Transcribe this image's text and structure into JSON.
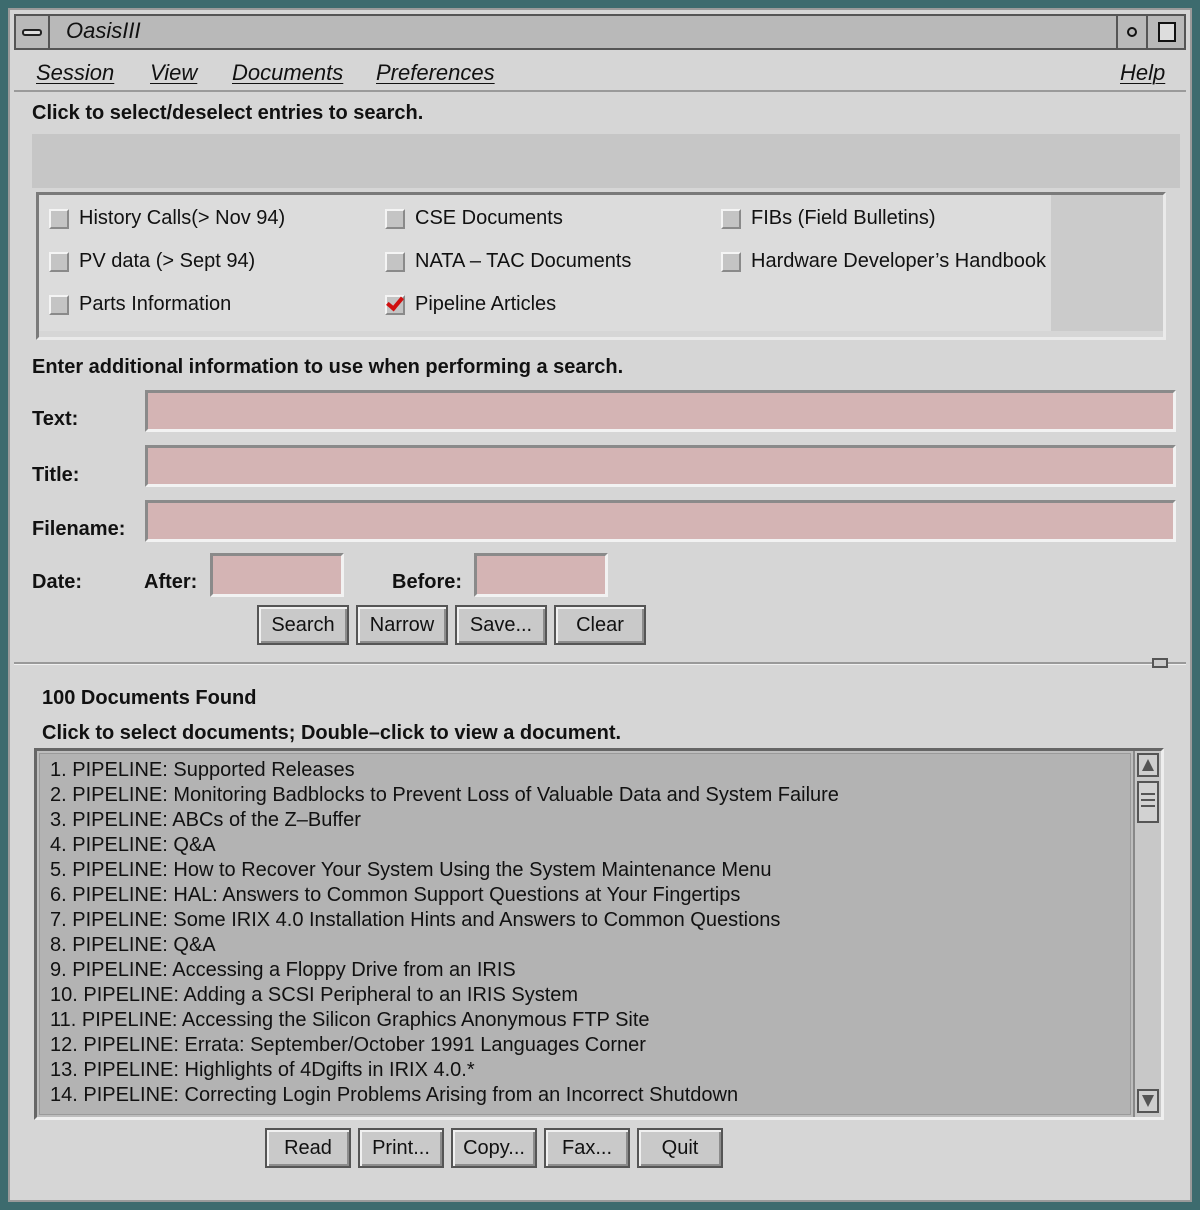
{
  "window": {
    "title": "OasisIII"
  },
  "menubar": {
    "session": "Session",
    "view": "View",
    "documents": "Documents",
    "preferences": "Preferences",
    "help": "Help"
  },
  "entries": {
    "instruction": "Click to select/deselect entries to search.",
    "items": [
      {
        "label": "History Calls(> Nov 94)",
        "checked": false
      },
      {
        "label": "CSE Documents",
        "checked": false
      },
      {
        "label": "FIBs (Field Bulletins)",
        "checked": false
      },
      {
        "label": "PV data (> Sept 94)",
        "checked": false
      },
      {
        "label": "NATA – TAC Documents",
        "checked": false
      },
      {
        "label": "Hardware Developer’s Handbook",
        "checked": false
      },
      {
        "label": "Parts Information",
        "checked": false
      },
      {
        "label": "Pipeline Articles",
        "checked": true
      }
    ]
  },
  "search_form": {
    "instruction": "Enter additional information to use when performing a search.",
    "text_label": "Text:",
    "text_value": "",
    "title_label": "Title:",
    "title_value": "",
    "filename_label": "Filename:",
    "filename_value": "",
    "date_label": "Date:",
    "after_label": "After:",
    "after_value": "",
    "before_label": "Before:",
    "before_value": "",
    "buttons": {
      "search": "Search",
      "narrow": "Narrow",
      "save": "Save...",
      "clear": "Clear"
    }
  },
  "results": {
    "count_text": "100 Documents Found",
    "instruction": "Click to select documents; Double–click to view a document.",
    "rows": [
      "1.  PIPELINE: Supported Releases",
      "2.  PIPELINE: Monitoring Badblocks to Prevent Loss of Valuable Data and System Failure",
      "3.  PIPELINE: ABCs of the Z–Buffer",
      "4.  PIPELINE: Q&A",
      "5.  PIPELINE: How to Recover Your System Using the System Maintenance Menu",
      "6.  PIPELINE: HAL: Answers to Common Support Questions at Your Fingertips",
      "7.  PIPELINE: Some IRIX 4.0 Installation Hints and Answers to Common Questions",
      "8.  PIPELINE: Q&A",
      "9.  PIPELINE: Accessing a Floppy Drive from an IRIS",
      "10.  PIPELINE: Adding a SCSI Peripheral to an IRIS System",
      "11.  PIPELINE: Accessing the Silicon Graphics Anonymous FTP Site",
      "12.  PIPELINE: Errata: September/October 1991 Languages Corner",
      "13.  PIPELINE: Highlights of 4Dgifts in IRIX 4.0.*",
      "14.  PIPELINE: Correcting Login Problems Arising from an Incorrect Shutdown"
    ],
    "buttons": {
      "read": "Read",
      "print": "Print...",
      "copy": "Copy...",
      "fax": "Fax...",
      "quit": "Quit"
    }
  },
  "colors": {
    "desktop": "#3d6b6e",
    "window_bg": "#d6d6d6",
    "field_bg": "#d4b4b4",
    "check_mark": "#d01010"
  }
}
